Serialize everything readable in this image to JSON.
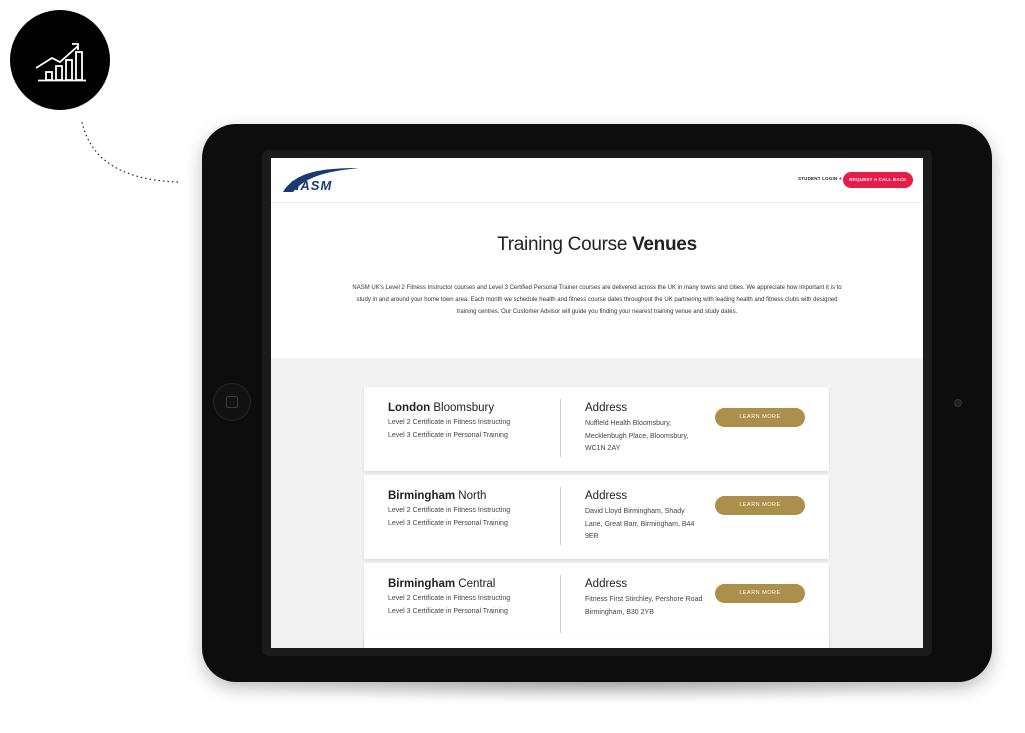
{
  "icons": {
    "badge": "bar-chart-growth-icon",
    "lock": "lock-icon",
    "home": "home-button-icon"
  },
  "colors": {
    "accent_red": "#e41c47",
    "gold": "#ad8f4c",
    "brand_navy": "#1a3a70",
    "section_bg": "#f2f2f2"
  },
  "header": {
    "logo_text": "NASM",
    "student_login": "STUDENT LOGIN",
    "request_callback": "REQUEST A CALL BACK"
  },
  "page": {
    "title_light": "Training Course ",
    "title_bold": "Venues",
    "intro": "NASM UK's Level 2 Fitness Instructor courses and Level 3 Certified Personal Trainer courses are delivered across the UK in many towns and cities. We appreciate how important it is to study in and around your home town area. Each month we schedule health and fitness course dates throughout the UK partnering with leading health and fitness clubs with designed training centres. Our Customer Advisor will guide you finding your nearest training venue and study dates."
  },
  "venues": [
    {
      "city": "London",
      "area": " Bloomsbury",
      "course_1": "Level 2 Certificate in Fitness Instructing",
      "course_2": "Level 3 Certificate in Personal Training",
      "address_heading": "Address",
      "address": "Nuffield Health Bloomsbury, Mecklenbugh Place, Bloomsbury, WC1N 2AY",
      "button": "LEARN MORE"
    },
    {
      "city": "Birmingham",
      "area": " North",
      "course_1": "Level 2 Certificate in Fitness Instructing",
      "course_2": "Level 3 Certificate in Personal Training",
      "address_heading": "Address",
      "address": "David Lloyd Birmingham, Shady Lane, Great Barr, Birmingham, B44 9ER",
      "button": "LEARN MORE"
    },
    {
      "city": "Birmingham",
      "area": " Central",
      "course_1": "Level 2 Certificate in Fitness Instructing",
      "course_2": "Level 3 Certificate in Personal Training",
      "address_heading": "Address",
      "address": "Fitness First Stirchley, Pershore Road Birmingham, B30 2YB",
      "button": "LEARN MORE"
    }
  ]
}
